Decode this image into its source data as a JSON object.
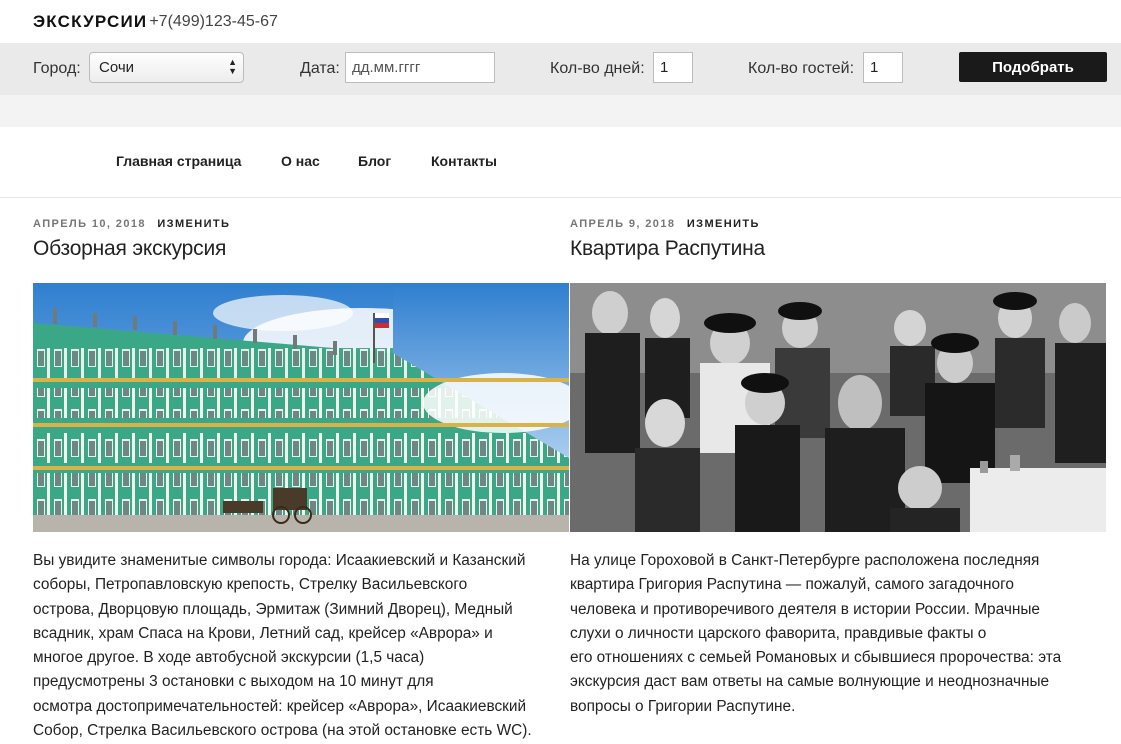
{
  "site": {
    "title": "ЭКСКУРСИИ",
    "phone": "+7(499)123-45-67"
  },
  "filter": {
    "city_label": "Город:",
    "city_value": "Сочи",
    "date_label": "Дата:",
    "date_placeholder": "дд.мм.гггг",
    "days_label": "Кол-во дней:",
    "days_value": "1",
    "guests_label": "Кол-во гостей:",
    "guests_value": "1",
    "submit_label": "Подобрать"
  },
  "nav": {
    "items": [
      "Главная страница",
      "О нас",
      "Блог",
      "Контакты"
    ]
  },
  "posts": [
    {
      "date": "АПРЕЛЬ 10, 2018",
      "edit": "ИЗМЕНИТЬ",
      "title": "Обзорная экскурсия",
      "text": "Вы увидите знаменитые символы города: Исаакиевский и Казанский\nсоборы, Петропавловскую крепость, Стрелку Васильевского\nострова, Дворцовую площадь, Эрмитаж (Зимний Дворец), Медный\nвсадник, храм Спаса на Крови, Летний сад, крейсер «Аврора» и\nмногое другое. В ходе автобусной экскурсии (1,5 часа)\nпредусмотрены 3 остановки с выходом на 10 минут для\nосмотра достопримечательностей: крейсер «Аврора», Исаакиевский\nСобор, Стрелка Васильевского острова (на этой остановке есть WC)."
    },
    {
      "date": "АПРЕЛЬ 9, 2018",
      "edit": "ИЗМЕНИТЬ",
      "title": "Квартира Распутина",
      "text": "На улице Гороховой в Санкт-Петербурге расположена последняя\nквартира Григория Распутина — пожалуй, самого загадочного\nчеловека и противоречивого деятеля в истории России. Мрачные\nслухи о личности царского фаворита, правдивые факты о\nего отношениях с семьей Романовых и сбывшиеся пророчества: эта\nэкскурсия даст вам ответы на самые волнующие и неоднозначные\nвопросы о Григории Распутине."
    }
  ]
}
